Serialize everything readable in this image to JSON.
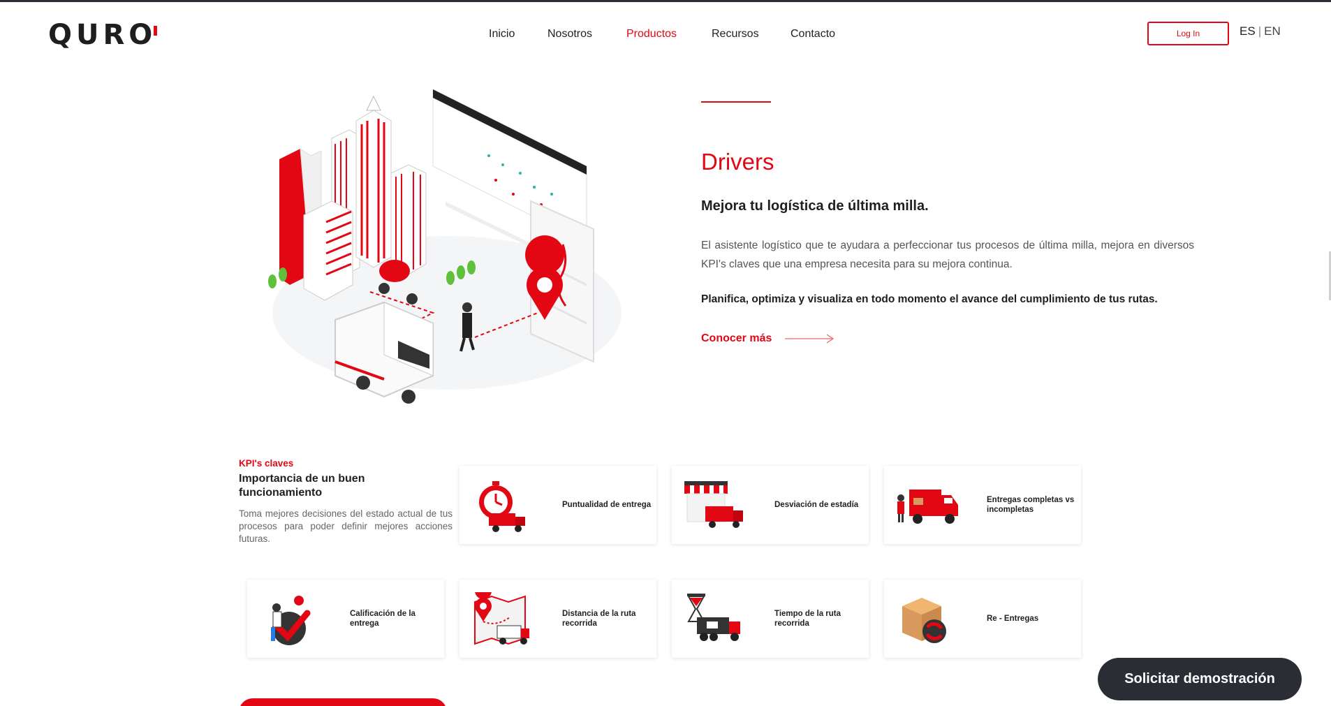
{
  "header": {
    "logo": "QURO",
    "nav": [
      {
        "label": "Inicio",
        "active": false
      },
      {
        "label": "Nosotros",
        "active": false
      },
      {
        "label": "Productos",
        "active": true
      },
      {
        "label": "Recursos",
        "active": false
      },
      {
        "label": "Contacto",
        "active": false
      }
    ],
    "login_label": "Log In",
    "lang_es": "ES",
    "lang_sep": "|",
    "lang_en": "EN"
  },
  "hero": {
    "title": "Drivers",
    "subtitle": "Mejora tu logística de última milla.",
    "description": "El asistente logístico que te ayudara a perfeccionar tus procesos de última milla, mejora en diversos KPI's claves que una empresa necesita para su mejora continua.",
    "highlight": "Planifica, optimiza y visualiza en todo momento el avance del cumplimiento de tus rutas.",
    "cta": "Conocer más"
  },
  "kpi": {
    "eyebrow": "KPI's claves",
    "title": "Importancia de un buen funcionamiento",
    "description": "Toma mejores decisiones del estado actual de tus procesos para poder definir mejores acciones futuras.",
    "cards": [
      {
        "label": "Puntualidad de entrega",
        "icon": "stopwatch-truck-icon"
      },
      {
        "label": "Desviación de estadía",
        "icon": "store-truck-icon"
      },
      {
        "label": "Entregas completas vs incompletas",
        "icon": "delivery-truck-icon"
      },
      {
        "label": "Calificación de la entrega",
        "icon": "rating-check-icon"
      },
      {
        "label": "Distancia de la ruta recorrida",
        "icon": "map-route-icon"
      },
      {
        "label": "Tiempo de la ruta recorrida",
        "icon": "hourglass-truck-icon"
      },
      {
        "label": "Re - Entregas",
        "icon": "box-redelivery-icon"
      }
    ]
  },
  "demo_button": "Solicitar demostración",
  "colors": {
    "accent": "#e30613",
    "dark": "#2a2d34"
  }
}
